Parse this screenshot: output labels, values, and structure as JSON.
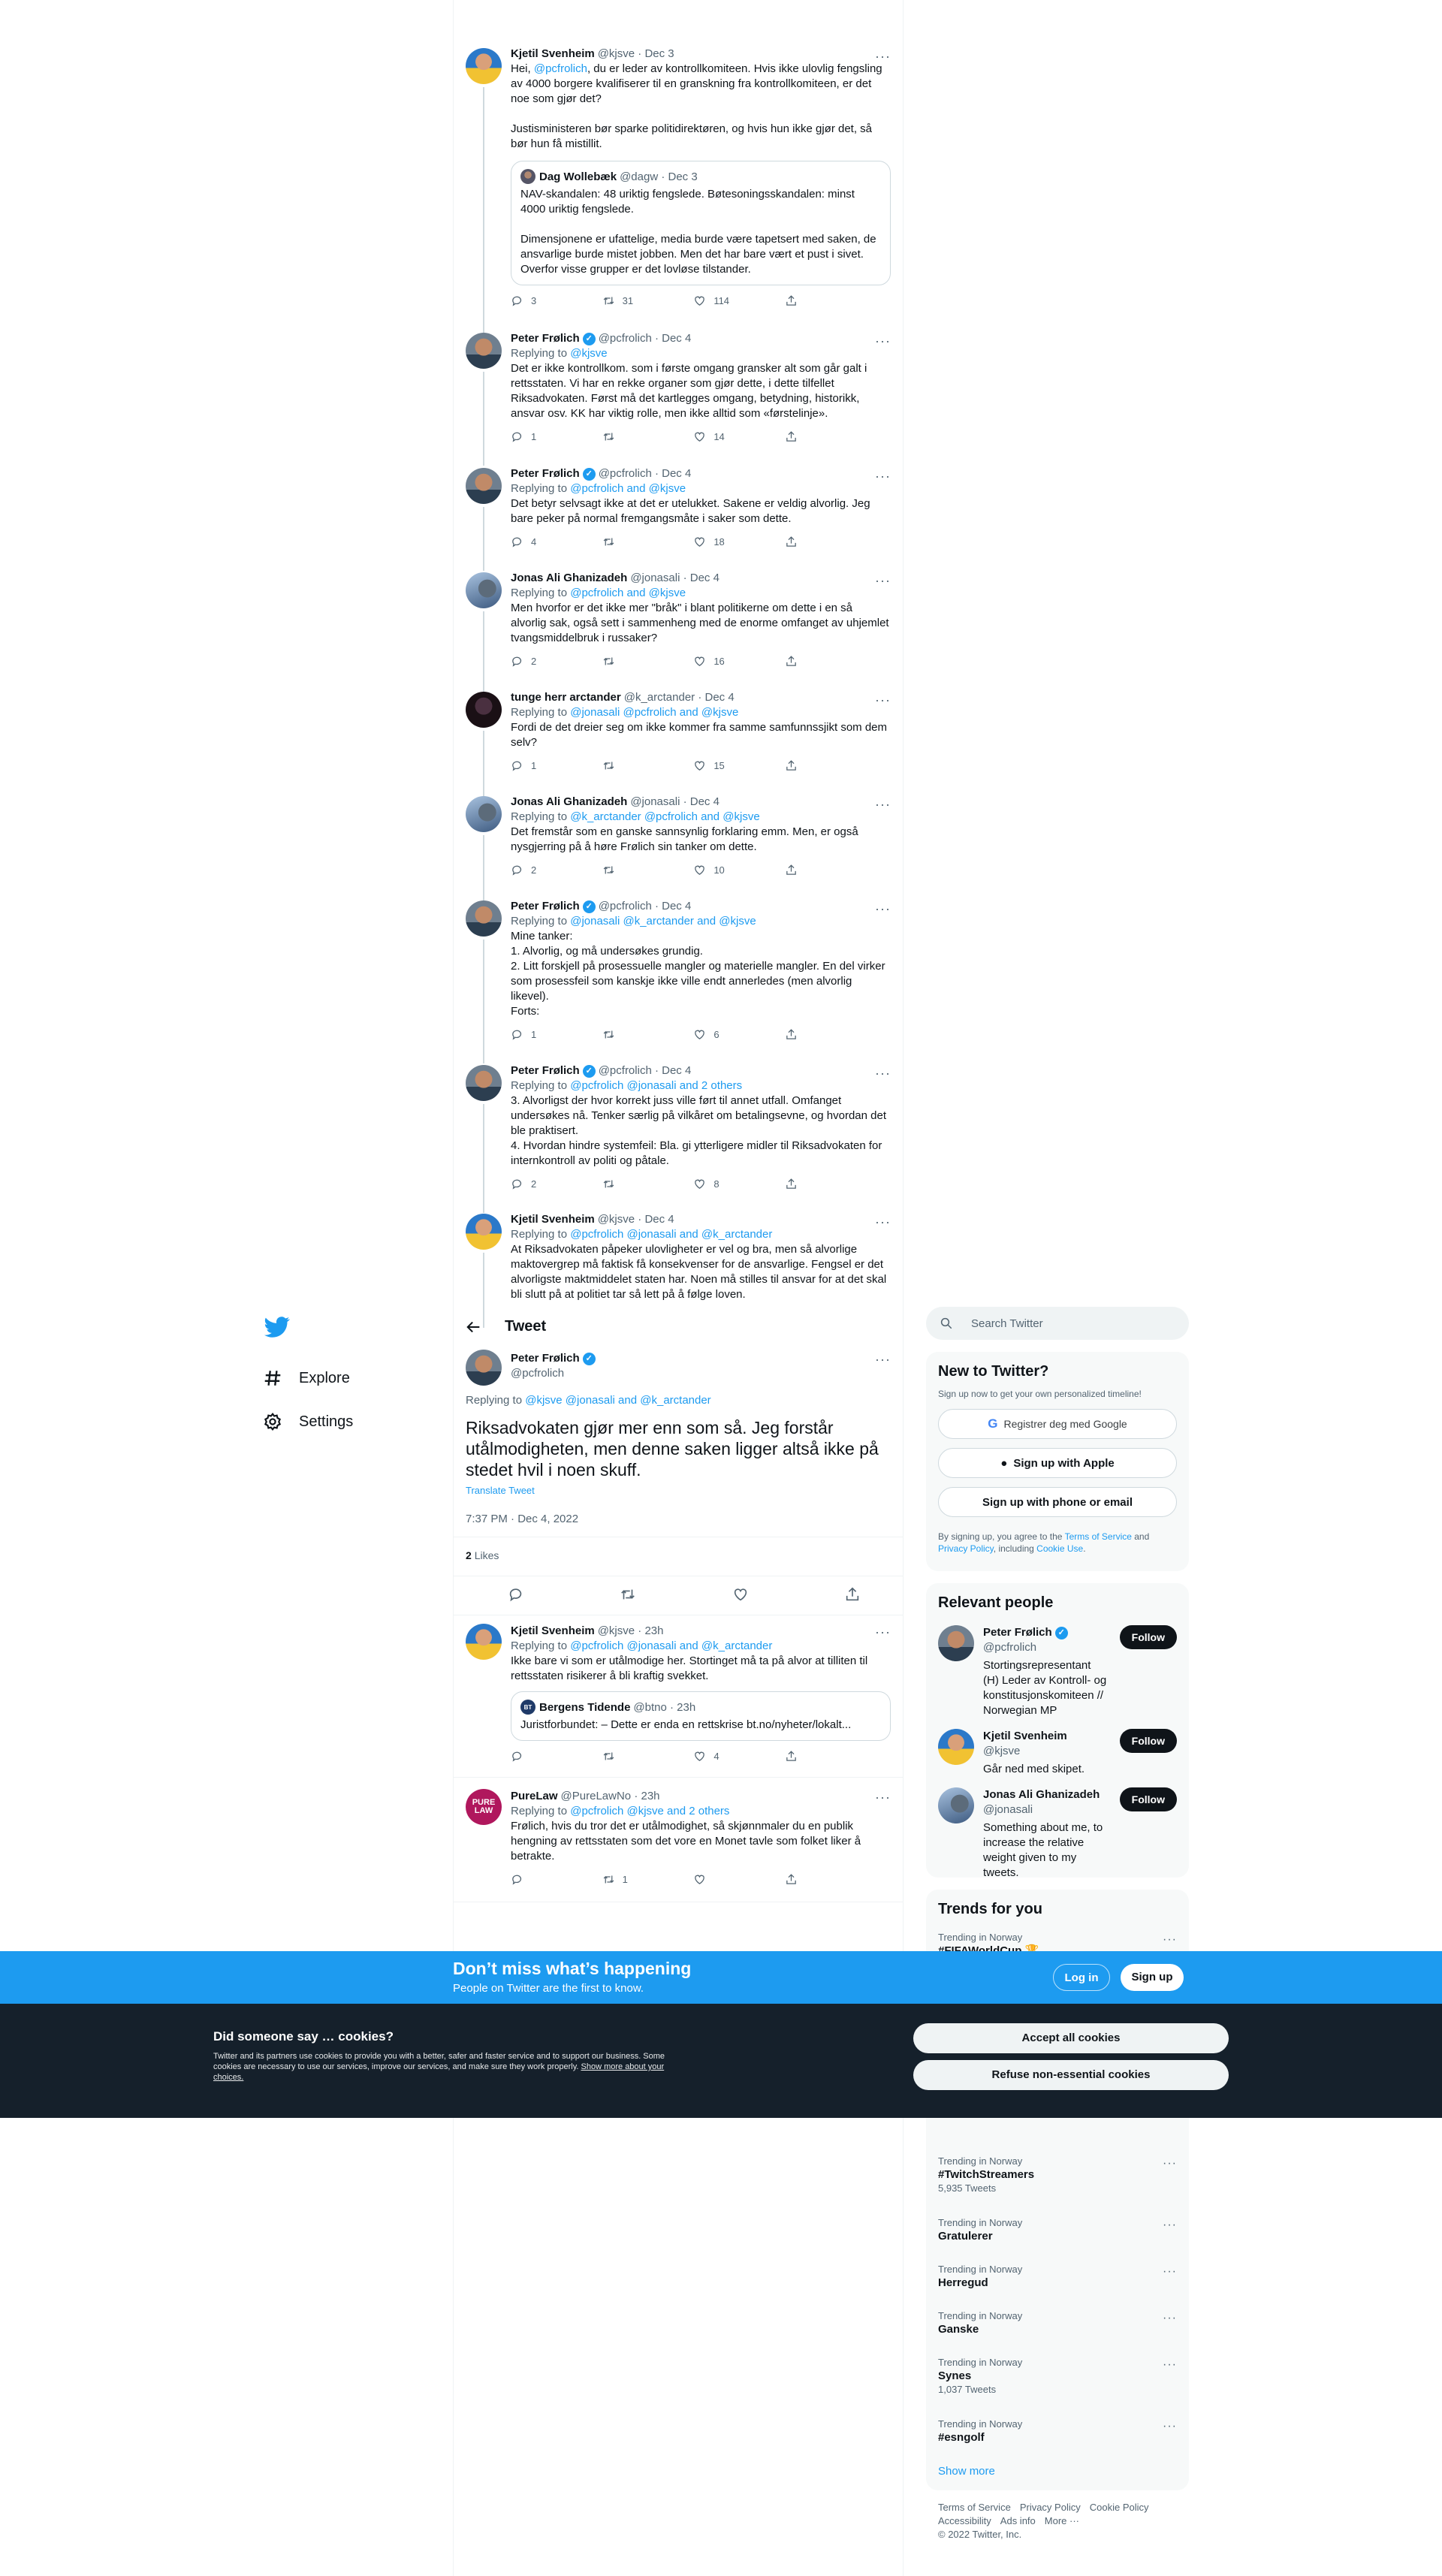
{
  "nav": {
    "logo": "twitter-bird-icon",
    "items": [
      {
        "label": "Explore",
        "icon": "hashtag-icon"
      },
      {
        "label": "Settings",
        "icon": "gear-icon"
      }
    ]
  },
  "thread": [
    {
      "name": "Kjetil Svenheim",
      "handle": "@kjsve",
      "date": "· Dec 3",
      "text_pre": "Hei, ",
      "text_mention": "@pcfrolich",
      "text_post": ", du er leder av kontrollkomiteen. Hvis ikke ulovlig fengsling av 4000 borgere kvalifiserer til en granskning fra kontrollkomiteen, er det noe som gjør det?\n\nJustisministeren bør sparke politidirektøren, og hvis hun ikke gjør det, så bør hun få mistillit.",
      "quote": {
        "name": "Dag Wollebæk",
        "handle": "@dagw",
        "date": "· Dec 3",
        "text": "NAV-skandalen: 48 uriktig fengslede. Bøtesoningsskandalen: minst 4000 uriktig fengslede.\n\nDimensjonene er ufattelige, media burde være tapetsert med saken, de ansvarlige burde mistet jobben. Men det har bare vært et pust i sivet. Overfor visse grupper er det lovløse tilstander."
      },
      "replies": "3",
      "retweets": "31",
      "likes": "114"
    },
    {
      "name": "Peter Frølich",
      "handle": "@pcfrolich",
      "date": "· Dec 4",
      "replying": "@kjsve",
      "text": "Det er ikke kontrollkom. som i første omgang gransker alt som går galt i rettsstaten. Vi har en rekke organer som gjør dette, i dette tilfellet Riksadvokaten. Først må det kartlegges omgang, betydning, historikk, ansvar osv. KK har viktig rolle, men ikke alltid som «førstelinje».",
      "replies": "1",
      "retweets": "",
      "likes": "14"
    },
    {
      "name": "Peter Frølich",
      "handle": "@pcfrolich",
      "date": "· Dec 4",
      "replying": "@pcfrolich and @kjsve",
      "text": "Det betyr selvsagt ikke at det er utelukket. Sakene er veldig alvorlig. Jeg bare peker på normal fremgangsmåte i saker som dette.",
      "replies": "4",
      "retweets": "",
      "likes": "18"
    },
    {
      "name": "Jonas Ali Ghanizadeh",
      "handle": "@jonasali",
      "date": "· Dec 4",
      "replying": "@pcfrolich and @kjsve",
      "text": "Men hvorfor er det ikke mer \"bråk\" i blant politikerne om dette i en så alvorlig sak, også sett i sammenheng med de enorme omfanget av uhjemlet tvangsmiddelbruk i russaker?",
      "replies": "2",
      "retweets": "",
      "likes": "16"
    },
    {
      "name": "tunge herr arctander",
      "handle": "@k_arctander",
      "date": "· Dec 4",
      "replying": "@jonasali @pcfrolich and @kjsve",
      "text": "Fordi de det dreier seg om ikke kommer fra samme samfunnssjikt som dem selv?",
      "replies": "1",
      "retweets": "",
      "likes": "15"
    },
    {
      "name": "Jonas Ali Ghanizadeh",
      "handle": "@jonasali",
      "date": "· Dec 4",
      "replying": "@k_arctander @pcfrolich and @kjsve",
      "text": "Det fremstår som en ganske sannsynlig forklaring emm. Men, er også nysgjerring på å høre Frølich sin tanker om dette.",
      "replies": "2",
      "retweets": "",
      "likes": "10"
    },
    {
      "name": "Peter Frølich",
      "handle": "@pcfrolich",
      "date": "· Dec 4",
      "replying": "@jonasali @k_arctander and @kjsve",
      "text": "Mine tanker:\n1. Alvorlig, og må undersøkes grundig.\n2. Litt forskjell på prosessuelle mangler og materielle mangler. En del virker som prosessfeil som kanskje ikke ville endt annerledes (men alvorlig likevel).\nForts:",
      "replies": "1",
      "retweets": "",
      "likes": "6"
    },
    {
      "name": "Peter Frølich",
      "handle": "@pcfrolich",
      "date": "· Dec 4",
      "replying": "@pcfrolich @jonasali and 2 others",
      "text": "3. Alvorligst der hvor korrekt juss ville ført til annet utfall. Omfanget undersøkes nå. Tenker særlig på vilkåret om betalingsevne, og hvordan det ble praktisert.\n4. Hvordan hindre systemfeil: Bla. gi ytterligere midler til Riksadvokaten for internkontroll av politi og påtale.",
      "replies": "2",
      "retweets": "",
      "likes": "8"
    },
    {
      "name": "Kjetil Svenheim",
      "handle": "@kjsve",
      "date": "· Dec 4",
      "replying": "@pcfrolich @jonasali and @k_arctander",
      "text": "At Riksadvokaten påpeker ulovligheter er vel og bra, men så alvorlige maktovergrep må faktisk få konsekvenser for de ansvarlige. Fengsel er det alvorligste maktmiddelet staten har. Noen må stilles til ansvar for at det skal bli slutt på at politiet tar så lett på å følge loven."
    }
  ],
  "main_header": "Tweet",
  "main_tweet": {
    "name": "Peter Frølich",
    "handle": "@pcfrolich",
    "replying_prefix": "Replying to",
    "replying": "@kjsve @jonasali and @k_arctander",
    "text": "Riksadvokaten gjør mer enn som så. Jeg forstår utålmodigheten, men denne saken ligger altså ikke på stedet hvil i noen skuff.",
    "translate": "Translate Tweet",
    "timestamp": "7:37 PM · Dec 4, 2022",
    "likes_count": "2",
    "likes_label": "Likes"
  },
  "replies": [
    {
      "name": "Kjetil Svenheim",
      "handle": "@kjsve",
      "date": "· 23h",
      "replying": "@pcfrolich @jonasali and @k_arctander",
      "text": "Ikke bare vi som er utålmodige her. Stortinget må ta på alvor at tilliten til rettsstaten risikerer å bli kraftig svekket.",
      "quote": {
        "name": "Bergens Tidende",
        "handle": "@btno",
        "date": "· 23h",
        "text": "Juristforbundet: – Dette er enda en rettskrise bt.no/nyheter/lokalt...",
        "logo": "BT"
      },
      "replies": "",
      "retweets": "",
      "likes": "4"
    },
    {
      "name": "PureLaw",
      "handle": "@PureLawNo",
      "date": "· 23h",
      "replying": "@pcfrolich @kjsve and 2 others",
      "text": "Frølich, hvis du tror det er utålmodighet, så skjønnmaler du en publik hengning av rettsstaten som det vore en Monet tavle som folket liker å betrakte.",
      "avatar_text": "PURE LAW",
      "replies": "",
      "retweets": "1",
      "likes": ""
    }
  ],
  "reply_prefix": "Replying to",
  "search_placeholder": "Search Twitter",
  "new_to_twitter": {
    "title": "New to Twitter?",
    "subtitle": "Sign up now to get your own personalized timeline!",
    "google": "Registrer deg med Google",
    "apple": "Sign up with Apple",
    "phone": "Sign up with phone or email",
    "terms_1": "By signing up, you agree to the ",
    "terms_link1": "Terms of Service",
    "terms_2": " and ",
    "terms_link2": "Privacy Policy",
    "terms_3": ", including ",
    "terms_link3": "Cookie Use",
    "terms_4": "."
  },
  "relevant": {
    "title": "Relevant people",
    "follow": "Follow",
    "people": [
      {
        "name": "Peter Frølich",
        "handle": "@pcfrolich",
        "bio": "Stortingsrepresentant (H) Leder av Kontroll- og konstitusjonskomiteen // Norwegian MP"
      },
      {
        "name": "Kjetil Svenheim",
        "handle": "@kjsve",
        "bio": "Går ned med skipet."
      },
      {
        "name": "Jonas Ali Ghanizadeh",
        "handle": "@jonasali",
        "bio": "Something about me, to increase the relative weight given to my tweets."
      }
    ]
  },
  "trends": {
    "title": "Trends for you",
    "first": {
      "context": "Trending in Norway",
      "name": "#FIFAWorldCup 🏆"
    },
    "items": [
      {
        "context": "Trending in Norway",
        "name": "#TwitchStreamers",
        "count": "5,935 Tweets"
      },
      {
        "context": "Trending in Norway",
        "name": "Gratulerer",
        "count": ""
      },
      {
        "context": "Trending in Norway",
        "name": "Herregud",
        "count": ""
      },
      {
        "context": "Trending in Norway",
        "name": "Ganske",
        "count": ""
      },
      {
        "context": "Trending in Norway",
        "name": "Synes",
        "count": "1,037 Tweets"
      },
      {
        "context": "Trending in Norway",
        "name": "#esngolf",
        "count": ""
      }
    ],
    "show_more": "Show more"
  },
  "footer": {
    "links": [
      "Terms of Service",
      "Privacy Policy",
      "Cookie Policy",
      "Accessibility",
      "Ads info",
      "More ···"
    ],
    "copyright": "© 2022 Twitter, Inc."
  },
  "signup_bar": {
    "title": "Don’t miss what’s happening",
    "subtitle": "People on Twitter are the first to know.",
    "login": "Log in",
    "signup": "Sign up"
  },
  "cookies": {
    "title": "Did someone say … cookies?",
    "text": "Twitter and its partners use cookies to provide you with a better, safer and faster service and to support our business. Some cookies are necessary to use our services, improve our services, and make sure they work properly. ",
    "link": "Show more about your choices.",
    "accept": "Accept all cookies",
    "refuse": "Refuse non-essential cookies"
  },
  "colors": {
    "accent": "#1d9bf0",
    "dark": "#0f1419",
    "cookie_bg": "#15202b"
  }
}
